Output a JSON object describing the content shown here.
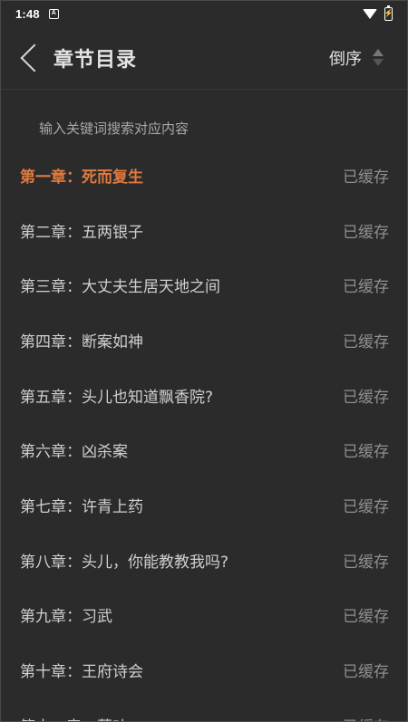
{
  "status_bar": {
    "time": "1:48",
    "notification_icon": "a-icon",
    "wifi_icon": "wifi-icon",
    "battery_icon": "battery-charging-icon"
  },
  "header": {
    "title": "章节目录",
    "sort_label": "倒序"
  },
  "search": {
    "placeholder": "输入关键词搜索对应内容"
  },
  "colors": {
    "background": "#2b2b2b",
    "accent": "#e07a3f",
    "text": "#cfcfcf",
    "muted": "#8f8f8f"
  },
  "chapters": [
    {
      "title": "第一章：死而复生",
      "status": "已缓存",
      "active": true
    },
    {
      "title": "第二章：五两银子",
      "status": "已缓存"
    },
    {
      "title": "第三章：大丈夫生居天地之间",
      "status": "已缓存"
    },
    {
      "title": "第四章：断案如神",
      "status": "已缓存"
    },
    {
      "title": "第五章：头儿也知道飘香院?",
      "status": "已缓存"
    },
    {
      "title": "第六章：凶杀案",
      "status": "已缓存"
    },
    {
      "title": "第七章：许青上药",
      "status": "已缓存"
    },
    {
      "title": "第八章：头儿，你能教教我吗?",
      "status": "已缓存"
    },
    {
      "title": "第九章：习武",
      "status": "已缓存"
    },
    {
      "title": "第十章：王府诗会",
      "status": "已缓存"
    },
    {
      "title": "第十一章：莫叶",
      "status": "已缓存"
    }
  ]
}
